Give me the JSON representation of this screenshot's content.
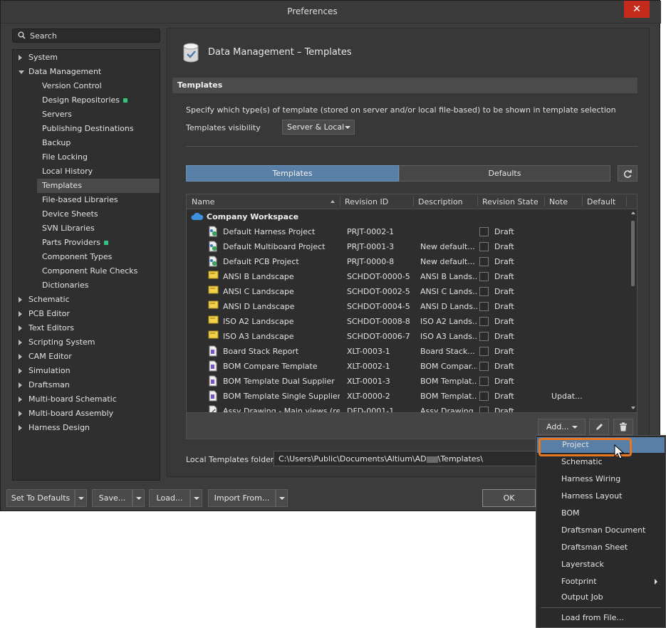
{
  "window": {
    "title": "Preferences",
    "close_label": "✕"
  },
  "search": {
    "placeholder": "Search"
  },
  "tree": [
    {
      "label": "System",
      "level": 0,
      "state": "collapsed"
    },
    {
      "label": "Data Management",
      "level": 0,
      "state": "expanded"
    },
    {
      "label": "Version Control",
      "level": 1
    },
    {
      "label": "Design Repositories",
      "level": 1,
      "badge": true
    },
    {
      "label": "Servers",
      "level": 1
    },
    {
      "label": "Publishing Destinations",
      "level": 1
    },
    {
      "label": "Backup",
      "level": 1
    },
    {
      "label": "File Locking",
      "level": 1
    },
    {
      "label": "Local History",
      "level": 1
    },
    {
      "label": "Templates",
      "level": 1,
      "selected": true
    },
    {
      "label": "File-based Libraries",
      "level": 1
    },
    {
      "label": "Device Sheets",
      "level": 1
    },
    {
      "label": "SVN Libraries",
      "level": 1
    },
    {
      "label": "Parts Providers",
      "level": 1,
      "badge": true
    },
    {
      "label": "Component Types",
      "level": 1
    },
    {
      "label": "Component Rule Checks",
      "level": 1
    },
    {
      "label": "Dictionaries",
      "level": 1
    },
    {
      "label": "Schematic",
      "level": 0,
      "state": "collapsed"
    },
    {
      "label": "PCB Editor",
      "level": 0,
      "state": "collapsed"
    },
    {
      "label": "Text Editors",
      "level": 0,
      "state": "collapsed"
    },
    {
      "label": "Scripting System",
      "level": 0,
      "state": "collapsed"
    },
    {
      "label": "CAM Editor",
      "level": 0,
      "state": "collapsed"
    },
    {
      "label": "Simulation",
      "level": 0,
      "state": "collapsed"
    },
    {
      "label": "Draftsman",
      "level": 0,
      "state": "collapsed"
    },
    {
      "label": "Multi-board Schematic",
      "level": 0,
      "state": "collapsed"
    },
    {
      "label": "Multi-board Assembly",
      "level": 0,
      "state": "collapsed"
    },
    {
      "label": "Harness Design",
      "level": 0,
      "state": "collapsed"
    }
  ],
  "panel": {
    "title": "Data Management – Templates",
    "section": "Templates",
    "description": "Specify which type(s) of template (stored on server and/or local file-based) to be shown in template selection",
    "visibility_label": "Templates visibility",
    "visibility_value": "Server & Local",
    "tab_templates": "Templates",
    "tab_defaults": "Defaults"
  },
  "table": {
    "columns": [
      "Name",
      "Revision ID",
      "Description",
      "Revision State",
      "Note",
      "Default"
    ],
    "group": "Company Workspace",
    "rows": [
      {
        "icon": "project",
        "name": "Default Harness Project",
        "rev": "PRJT-0002-1",
        "desc": "",
        "state": "Draft",
        "note": ""
      },
      {
        "icon": "project",
        "name": "Default Multiboard Project",
        "rev": "PRJT-0001-3",
        "desc": "New default...",
        "state": "Draft",
        "note": ""
      },
      {
        "icon": "project",
        "name": "Default PCB Project",
        "rev": "PRJT-0000-8",
        "desc": "New default...",
        "state": "Draft",
        "note": ""
      },
      {
        "icon": "sheet",
        "name": "ANSI B Landscape",
        "rev": "SCHDOT-0000-5",
        "desc": "ANSI B Lands...",
        "state": "Draft",
        "note": ""
      },
      {
        "icon": "sheet",
        "name": "ANSI C Landscape",
        "rev": "SCHDOT-0002-5",
        "desc": "ANSI C Lands...",
        "state": "Draft",
        "note": ""
      },
      {
        "icon": "sheet",
        "name": "ANSI D Landscape",
        "rev": "SCHDOT-0004-5",
        "desc": "ANSI D Lands...",
        "state": "Draft",
        "note": ""
      },
      {
        "icon": "sheet",
        "name": "ISO A2 Landscape",
        "rev": "SCHDOT-0008-8",
        "desc": "ISO A2 Lands...",
        "state": "Draft",
        "note": ""
      },
      {
        "icon": "sheet",
        "name": "ISO A3 Landscape",
        "rev": "SCHDOT-0006-7",
        "desc": "ISO A3 Lands...",
        "state": "Draft",
        "note": ""
      },
      {
        "icon": "report",
        "name": "Board Stack Report",
        "rev": "XLT-0003-1",
        "desc": "Board Stack...",
        "state": "Draft",
        "note": ""
      },
      {
        "icon": "report",
        "name": "BOM Compare Template",
        "rev": "XLT-0002-1",
        "desc": "BOM Compar...",
        "state": "Draft",
        "note": ""
      },
      {
        "icon": "report",
        "name": "BOM Template Dual Supplier",
        "rev": "XLT-0001-3",
        "desc": "BOM Templat...",
        "state": "Draft",
        "note": ""
      },
      {
        "icon": "report",
        "name": "BOM Template Single Supplier",
        "rev": "XLT-0000-2",
        "desc": "BOM Templat...",
        "state": "Draft",
        "note": "Updat..."
      },
      {
        "icon": "drawing",
        "name": "Assy Drawing - Main views (rect...",
        "rev": "DFD-0001-1",
        "desc": "Assy Drawing...",
        "state": "Draft",
        "note": ""
      }
    ]
  },
  "toolbar": {
    "add_label": "Add..."
  },
  "folder": {
    "label": "Local Templates folder",
    "path": "C:\\Users\\Public\\Documents\\Altium\\AD",
    "path_suffix": "\\Templates\\"
  },
  "bottom": {
    "set_defaults": "Set To Defaults",
    "save": "Save...",
    "load": "Load...",
    "import": "Import From...",
    "ok": "OK"
  },
  "menu": [
    {
      "label": "Project",
      "active": true
    },
    {
      "label": "Schematic"
    },
    {
      "label": "Harness  Wiring"
    },
    {
      "label": "Harness Layout"
    },
    {
      "label": "BOM"
    },
    {
      "label": "Draftsman Document"
    },
    {
      "label": "Draftsman Sheet"
    },
    {
      "label": "Layerstack"
    },
    {
      "label": "Footprint",
      "submenu": true
    },
    {
      "label": "Output Job"
    },
    {
      "label": "Load from File..."
    }
  ],
  "colors": {
    "accent": "#5a7fa6",
    "highlight": "#e87722",
    "window_bg": "#3c3c3c",
    "close": "#c42b1c"
  }
}
